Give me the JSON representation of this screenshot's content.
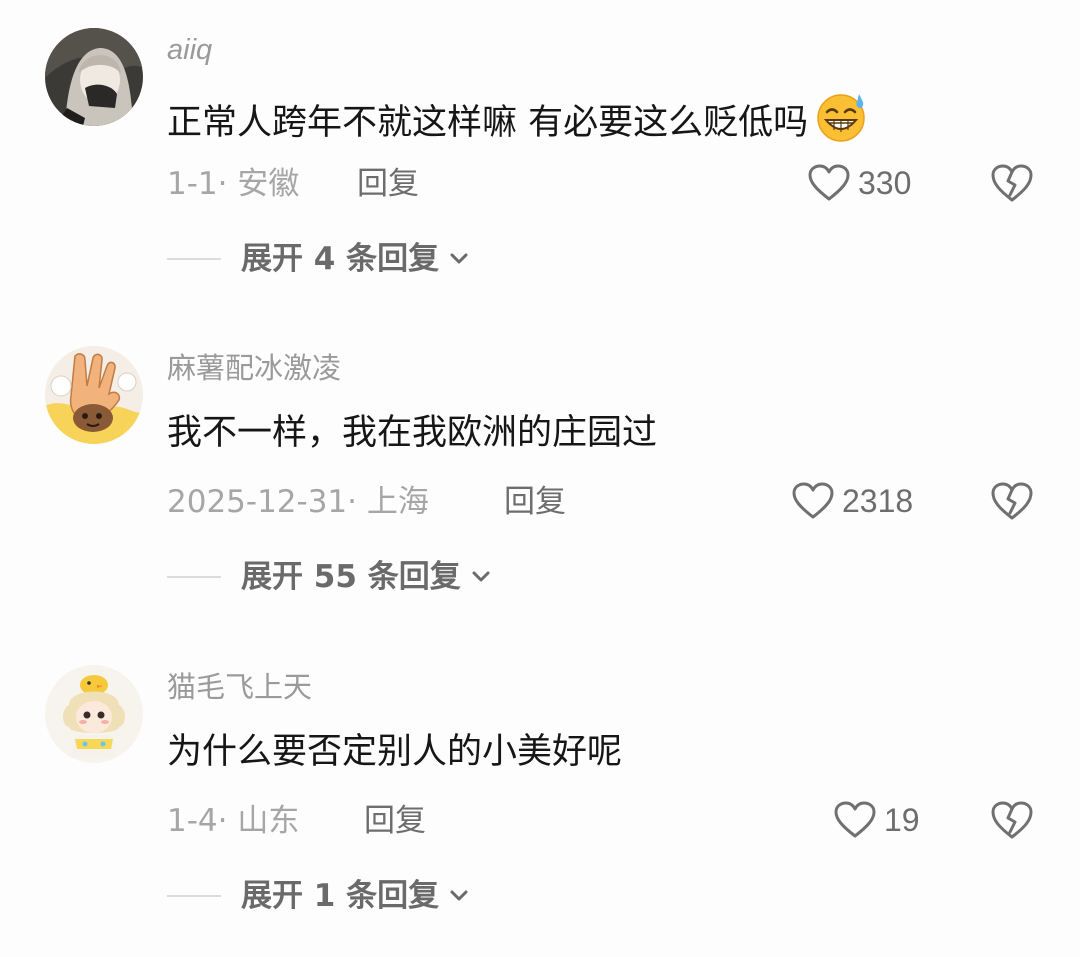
{
  "comments": [
    {
      "username": "aiiq",
      "text": "正常人跨年不就这样嘛 有必要这么贬低吗",
      "emoji": "sweat-smile-emoji",
      "meta": "1-1· 安徽",
      "reply_label": "回复",
      "likes": "330",
      "expand_label": "展开 4 条回复"
    },
    {
      "username": "麻薯配冰激凌",
      "text": "我不一样，我在我欧洲的庄园过",
      "meta": "2025-12-31· 上海",
      "reply_label": "回复",
      "likes": "2318",
      "expand_label": "展开 55 条回复"
    },
    {
      "username": "猫毛飞上天",
      "text": "为什么要否定别人的小美好呢",
      "meta": "1-4· 山东",
      "reply_label": "回复",
      "likes": "19",
      "expand_label": "展开 1 条回复"
    }
  ],
  "icons": {
    "like": "heart-outline-icon",
    "dislike": "broken-heart-icon",
    "expand": "chevron-down-icon"
  },
  "colors": {
    "background": "#fdfdfd",
    "text_primary": "#161616",
    "text_secondary": "#9a9a9a",
    "action_text": "#6d6d6d"
  }
}
